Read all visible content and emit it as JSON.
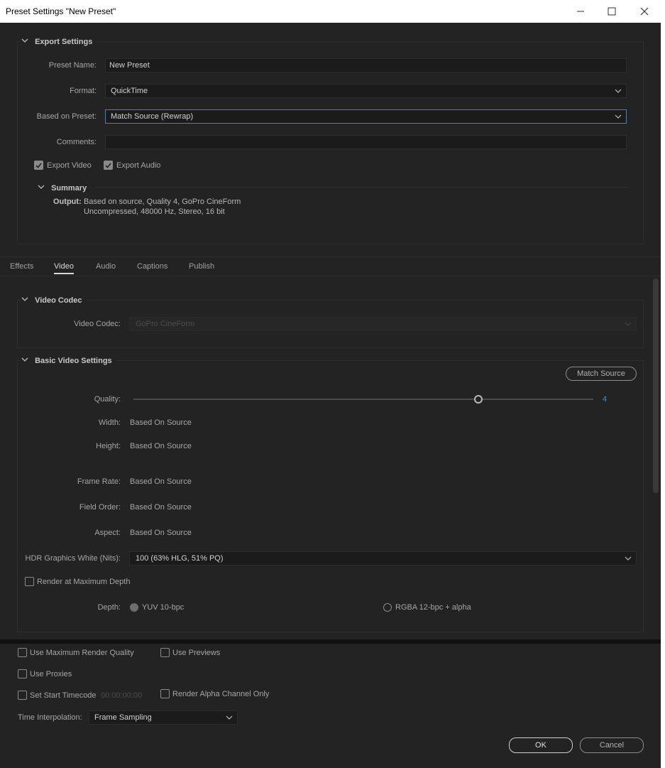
{
  "window": {
    "title": "Preset Settings \"New Preset\""
  },
  "export_settings": {
    "header": "Export Settings",
    "preset_name_label": "Preset Name:",
    "preset_name_value": "New Preset",
    "format_label": "Format:",
    "format_value": "QuickTime",
    "based_on_label": "Based on Preset:",
    "based_on_value": "Match Source (Rewrap)",
    "comments_label": "Comments:",
    "comments_value": "",
    "export_video_label": "Export Video",
    "export_video_checked": true,
    "export_audio_label": "Export Audio",
    "export_audio_checked": true
  },
  "summary": {
    "header": "Summary",
    "output_label": "Output:",
    "output_line1": "Based on source, Quality 4, GoPro CineForm",
    "output_line2": "Uncompressed, 48000 Hz, Stereo, 16 bit"
  },
  "tabs": [
    {
      "label": "Effects",
      "active": false
    },
    {
      "label": "Video",
      "active": true
    },
    {
      "label": "Audio",
      "active": false
    },
    {
      "label": "Captions",
      "active": false
    },
    {
      "label": "Publish",
      "active": false
    }
  ],
  "video_codec": {
    "header": "Video Codec",
    "codec_label": "Video Codec:",
    "codec_value": "GoPro CineForm"
  },
  "basic_video": {
    "header": "Basic Video Settings",
    "match_source_button": "Match Source",
    "quality_label": "Quality:",
    "quality_value": "4",
    "quality_fraction": 0.75,
    "width_label": "Width:",
    "width_value": "Based On Source",
    "height_label": "Height:",
    "height_value": "Based On Source",
    "frame_rate_label": "Frame Rate:",
    "frame_rate_value": "Based On Source",
    "field_order_label": "Field Order:",
    "field_order_value": "Based On Source",
    "aspect_label": "Aspect:",
    "aspect_value": "Based On Source",
    "hdr_label": "HDR Graphics White (Nits):",
    "hdr_value": "100 (63% HLG, 51% PQ)",
    "render_max_depth_label": "Render at Maximum Depth",
    "depth_label": "Depth:",
    "depth_option1": "YUV 10-bpc",
    "depth_option2": "RGBA 12-bpc + alpha"
  },
  "bottom": {
    "use_max_render_quality": "Use Maximum Render Quality",
    "use_previews": "Use Previews",
    "use_proxies": "Use Proxies",
    "set_start_timecode": "Set Start Timecode",
    "timecode_value": "00:00:00:00",
    "render_alpha_only": "Render Alpha Channel Only",
    "time_interpolation_label": "Time Interpolation:",
    "time_interpolation_value": "Frame Sampling",
    "ok_button": "OK",
    "cancel_button": "Cancel"
  },
  "colors": {
    "background": "#232323",
    "focus_border": "#4a7ed0",
    "quality_value_color": "#3b8de0"
  }
}
